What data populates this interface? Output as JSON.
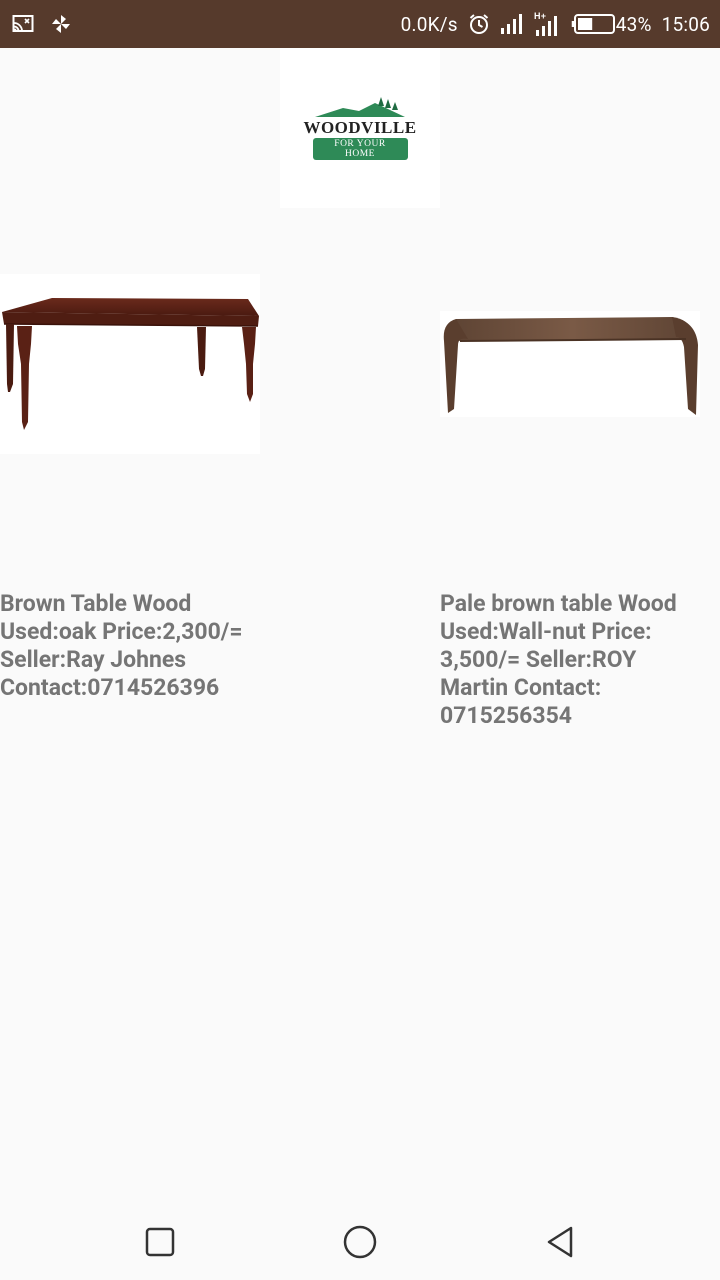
{
  "status_bar": {
    "network_speed": "0.0K/s",
    "network_type": "H+",
    "battery_percent": "43%",
    "battery_level": 0.43,
    "time": "15:06",
    "icons": [
      "cast-icon",
      "pinwheel-icon",
      "alarm-icon",
      "signal-icon",
      "signal-h-plus-icon",
      "battery-icon"
    ]
  },
  "logo": {
    "brand": "WOODVILLE",
    "tagline": "FOR YOUR HOME",
    "brand_color": "#2e8a57"
  },
  "products": [
    {
      "image": "brown-dining-table-image",
      "description": "Brown Table Wood Used:oak Price:2,300/= Seller:Ray Johnes Contact:0714526396"
    },
    {
      "image": "pale-brown-coffee-table-image",
      "description": "Pale brown table Wood Used:Wall-nut Price: 3,500/= Seller:ROY Martin Contact: 0715256354"
    }
  ],
  "nav_bar": {
    "icons": [
      "recent-apps-icon",
      "home-icon",
      "back-icon"
    ]
  },
  "colors": {
    "status_bar": "#563a2c",
    "background": "#fafafa",
    "text": "#757575"
  }
}
